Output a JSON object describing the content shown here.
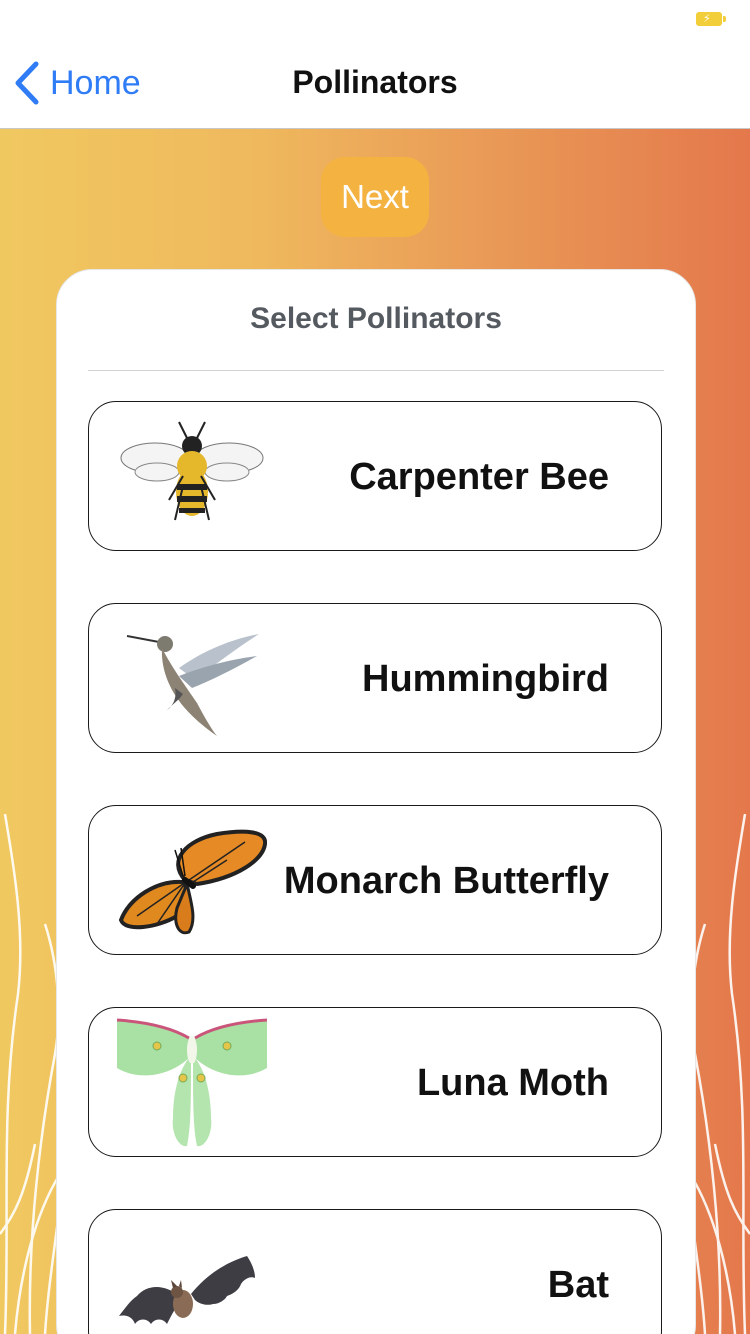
{
  "nav": {
    "back_label": "Home",
    "title": "Pollinators"
  },
  "next_label": "Next",
  "card": {
    "title": "Select Pollinators",
    "items": [
      {
        "label": "Carpenter Bee",
        "icon": "bee-image"
      },
      {
        "label": "Hummingbird",
        "icon": "hummingbird-image"
      },
      {
        "label": "Monarch Butterfly",
        "icon": "butterfly-image"
      },
      {
        "label": "Luna Moth",
        "icon": "moth-image"
      },
      {
        "label": "Bat",
        "icon": "bat-image"
      }
    ]
  },
  "colors": {
    "accent_blue": "#2f7cf6",
    "next_button": "#f4b341",
    "gradient_start": "#f0c860",
    "gradient_end": "#e4784c"
  }
}
